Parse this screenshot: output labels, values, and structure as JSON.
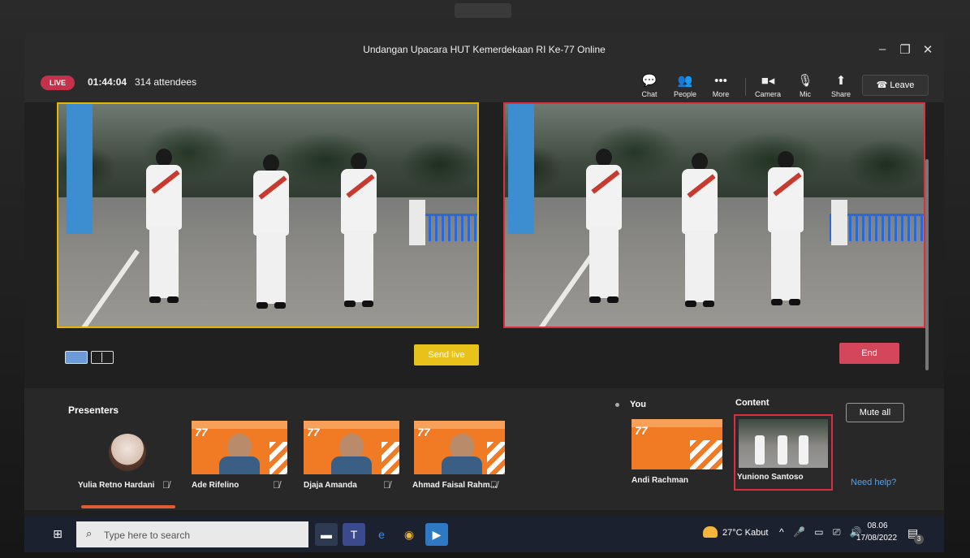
{
  "window": {
    "title": "Undangan Upacara HUT Kemerdekaan RI Ke-77 Online",
    "controls": [
      "–",
      "❐",
      "✕"
    ]
  },
  "livebar": {
    "live_label": "LIVE",
    "timer": "01:44:04",
    "attendees": "314 attendees",
    "tools": [
      {
        "icon": "chat-icon",
        "glyph": "💬",
        "label": "Chat"
      },
      {
        "icon": "people-icon",
        "glyph": "👥",
        "label": "People"
      },
      {
        "icon": "more-icon",
        "glyph": "•••",
        "label": "More"
      },
      {
        "icon": "camera-icon",
        "glyph": "■◂",
        "label": "Camera"
      },
      {
        "icon": "mic-off-icon",
        "glyph": "🎙",
        "label": "Mic"
      },
      {
        "icon": "share-icon",
        "glyph": "⬆",
        "label": "Share"
      }
    ],
    "leave_label": "Leave"
  },
  "stage": {
    "send_live_label": "Send live",
    "end_label": "End"
  },
  "presenters": {
    "title": "Presenters",
    "people": [
      {
        "name": "Yulia Retno Hardani"
      },
      {
        "name": "Ade Rifelino"
      },
      {
        "name": "Djaja Amanda"
      },
      {
        "name": "Ahmad Faisal Rahm..."
      }
    ]
  },
  "you": {
    "title": "You",
    "name": "Andi Rachman"
  },
  "content": {
    "title": "Content",
    "name": "Yuniono Santoso"
  },
  "panel": {
    "mute_all_label": "Mute all",
    "need_help_label": "Need help?"
  },
  "taskbar": {
    "search_placeholder": "Type here to search",
    "weather": "27°C  Kabut",
    "time": "08.06",
    "date": "17/08/2022",
    "notification_count": "3"
  },
  "colors": {
    "live": "#c4314b",
    "send_live": "#e8c21a",
    "end": "#d4475a",
    "queue_border": "#e3b400",
    "live_border": "#d9303f",
    "tile_orange": "#f07b24"
  }
}
